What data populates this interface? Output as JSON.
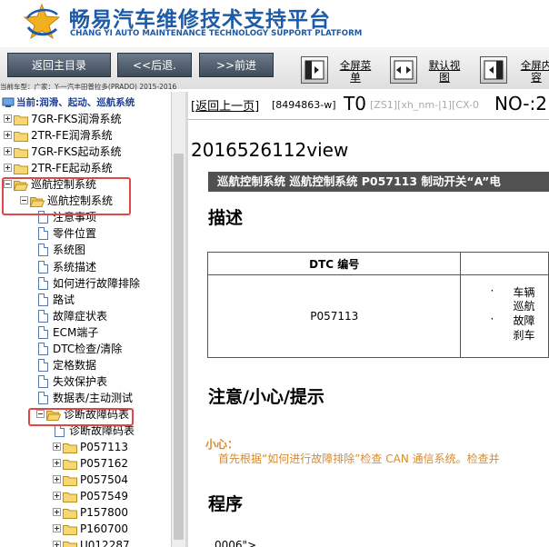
{
  "header": {
    "title_cn": "畅易汽车维修技术支持平台",
    "title_en": "CHANG YI AUTO MAINTENANCE TECHNOLOGY SUPPORT PLATFORM",
    "logo_icon": "cy-star-logo-icon",
    "brand_color": "#1d5aa8"
  },
  "toolbar": {
    "back_main": "返回主目录",
    "back": "<<后退.",
    "forward": ">>前进",
    "fullscreen_menu": "全屏菜单",
    "default_view": "默认视图",
    "fullscreen_content": "全屏内容"
  },
  "car_info": "当前车型：广家：Y-一汽丰田普拉多(PRADO) 2015-2016",
  "tree": {
    "current": "当前:润滑、起动、巡航系统",
    "items": [
      {
        "label": "7GR-FKS润滑系统"
      },
      {
        "label": "2TR-FE润滑系统"
      },
      {
        "label": "7GR-FKS起动系统"
      },
      {
        "label": "2TR-FE起动系统"
      },
      {
        "label": "巡航控制系统"
      },
      {
        "label": "巡航控制系统"
      },
      {
        "label": "注意事项"
      },
      {
        "label": "零件位置"
      },
      {
        "label": "系统图"
      },
      {
        "label": "系统描述"
      },
      {
        "label": "如何进行故障排除"
      },
      {
        "label": "路试"
      },
      {
        "label": "故障症状表"
      },
      {
        "label": "ECM端子"
      },
      {
        "label": "DTC检查/清除"
      },
      {
        "label": "定格数据"
      },
      {
        "label": "失效保护表"
      },
      {
        "label": "数据表/主动测试"
      },
      {
        "label": "诊断故障码表"
      },
      {
        "label": "诊断故障码表"
      },
      {
        "label": "P057113"
      },
      {
        "label": "P057162"
      },
      {
        "label": "P057504"
      },
      {
        "label": "P057549"
      },
      {
        "label": "P157800"
      },
      {
        "label": "P160700"
      },
      {
        "label": "U012287"
      }
    ]
  },
  "content": {
    "back_link": "返回上一页",
    "code": "[8494863-w]",
    "t0": "T0",
    "zs": "[ZS1][xh_nm-|1][CX-0",
    "no": "NO-:2",
    "view_id": "2016526112view",
    "banner": "巡航控制系统  巡航控制系统  P057113  制动开关“A”电",
    "heading_desc": "描述",
    "dtc_header": "DTC 编号",
    "dtc_value": "P057113",
    "dtc_desc_lines": [
      "车辆",
      "巡航",
      "故障",
      "刹车"
    ],
    "heading_caution": "注意/小心/提示",
    "hint_title": "小心：",
    "hint_text": "首先根据“如何进行故障排除”检查 CAN 通信系统。检查并",
    "heading_procedure": "程序",
    "code_line": "0006\">"
  },
  "colors": {
    "highlight": "#e04848",
    "banner_bg": "#515151",
    "hint": "#d88a2c"
  }
}
